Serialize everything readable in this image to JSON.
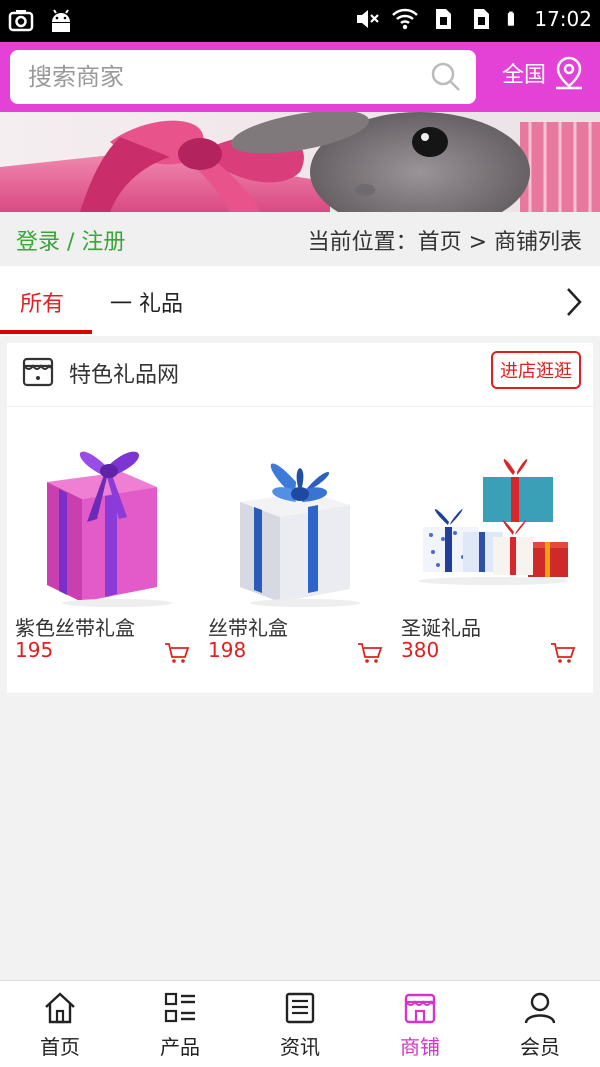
{
  "status_bar": {
    "time": "17:02",
    "icons": [
      "screenshot-icon",
      "android-icon",
      "mute-icon",
      "wifi-icon",
      "sim1-icon",
      "sim2-icon",
      "battery-icon"
    ]
  },
  "header": {
    "search_placeholder": "搜索商家",
    "region_label": "全国",
    "accent_color": "#e442d6"
  },
  "user_bar": {
    "login_label": "登录 / 注册",
    "breadcrumb": "当前位置：首页 > 商铺列表"
  },
  "tabs": {
    "all_label": "所有",
    "gift_label": "一 礼品"
  },
  "shop": {
    "name": "特色礼品网",
    "enter_label": "进店逛逛",
    "products": [
      {
        "name": "紫色丝带礼盒",
        "price": "195"
      },
      {
        "name": "丝带礼盒",
        "price": "198"
      },
      {
        "name": "圣诞礼品",
        "price": "380"
      }
    ]
  },
  "bottom_nav": [
    {
      "label": "首页",
      "icon": "home-icon",
      "active": false
    },
    {
      "label": "产品",
      "icon": "grid-list-icon",
      "active": false
    },
    {
      "label": "资讯",
      "icon": "news-icon",
      "active": false
    },
    {
      "label": "商铺",
      "icon": "store-icon",
      "active": true
    },
    {
      "label": "会员",
      "icon": "user-icon",
      "active": false
    }
  ],
  "colors": {
    "price": "#e02020",
    "login": "#3aa53a",
    "active_nav": "#d633c9"
  }
}
